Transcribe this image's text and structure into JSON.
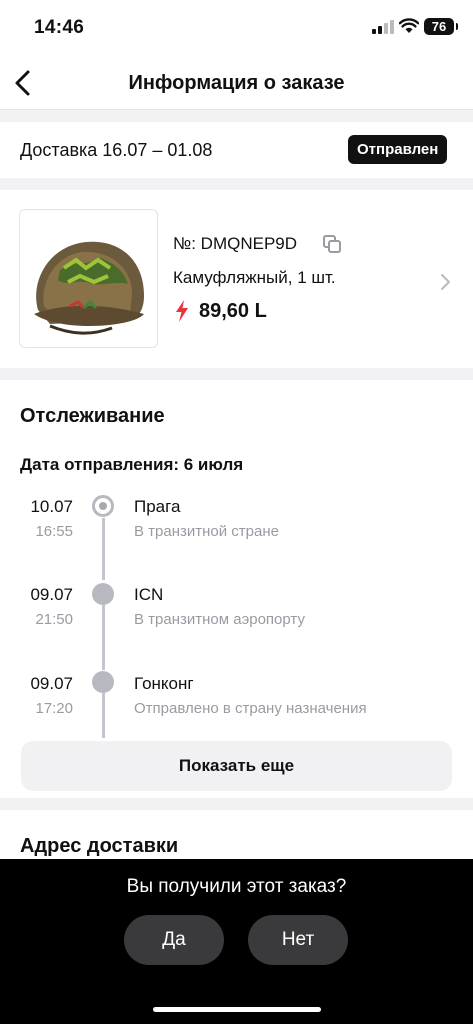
{
  "status_bar": {
    "time": "14:46",
    "battery": "76"
  },
  "header": {
    "title": "Информация о заказе",
    "back_icon": "chevron-left-icon"
  },
  "delivery": {
    "label": "Доставка 16.07 – 01.08",
    "status": "Отправлен"
  },
  "product": {
    "order_number": "№: DMQNEP9D",
    "variant": "Камуфляжный, 1 шт.",
    "price": "89,60 L",
    "price_icon": "lightning-icon",
    "accent_color": "#e8333b"
  },
  "tracking": {
    "heading": "Отслеживание",
    "ship_date": "Дата отправления: 6 июля",
    "events": [
      {
        "date": "10.07",
        "time": "16:55",
        "place": "Прага",
        "desc": "В транзитной стране"
      },
      {
        "date": "09.07",
        "time": "21:50",
        "place": "ICN",
        "desc": "В транзитном аэропорту"
      },
      {
        "date": "09.07",
        "time": "17:20",
        "place": "Гонконг",
        "desc": "Отправлено в страну назначения"
      }
    ],
    "show_more": "Показать еще"
  },
  "address": {
    "heading": "Адрес доставки"
  },
  "prompt": {
    "question": "Вы получили этот заказ?",
    "yes": "Да",
    "no": "Нет"
  }
}
